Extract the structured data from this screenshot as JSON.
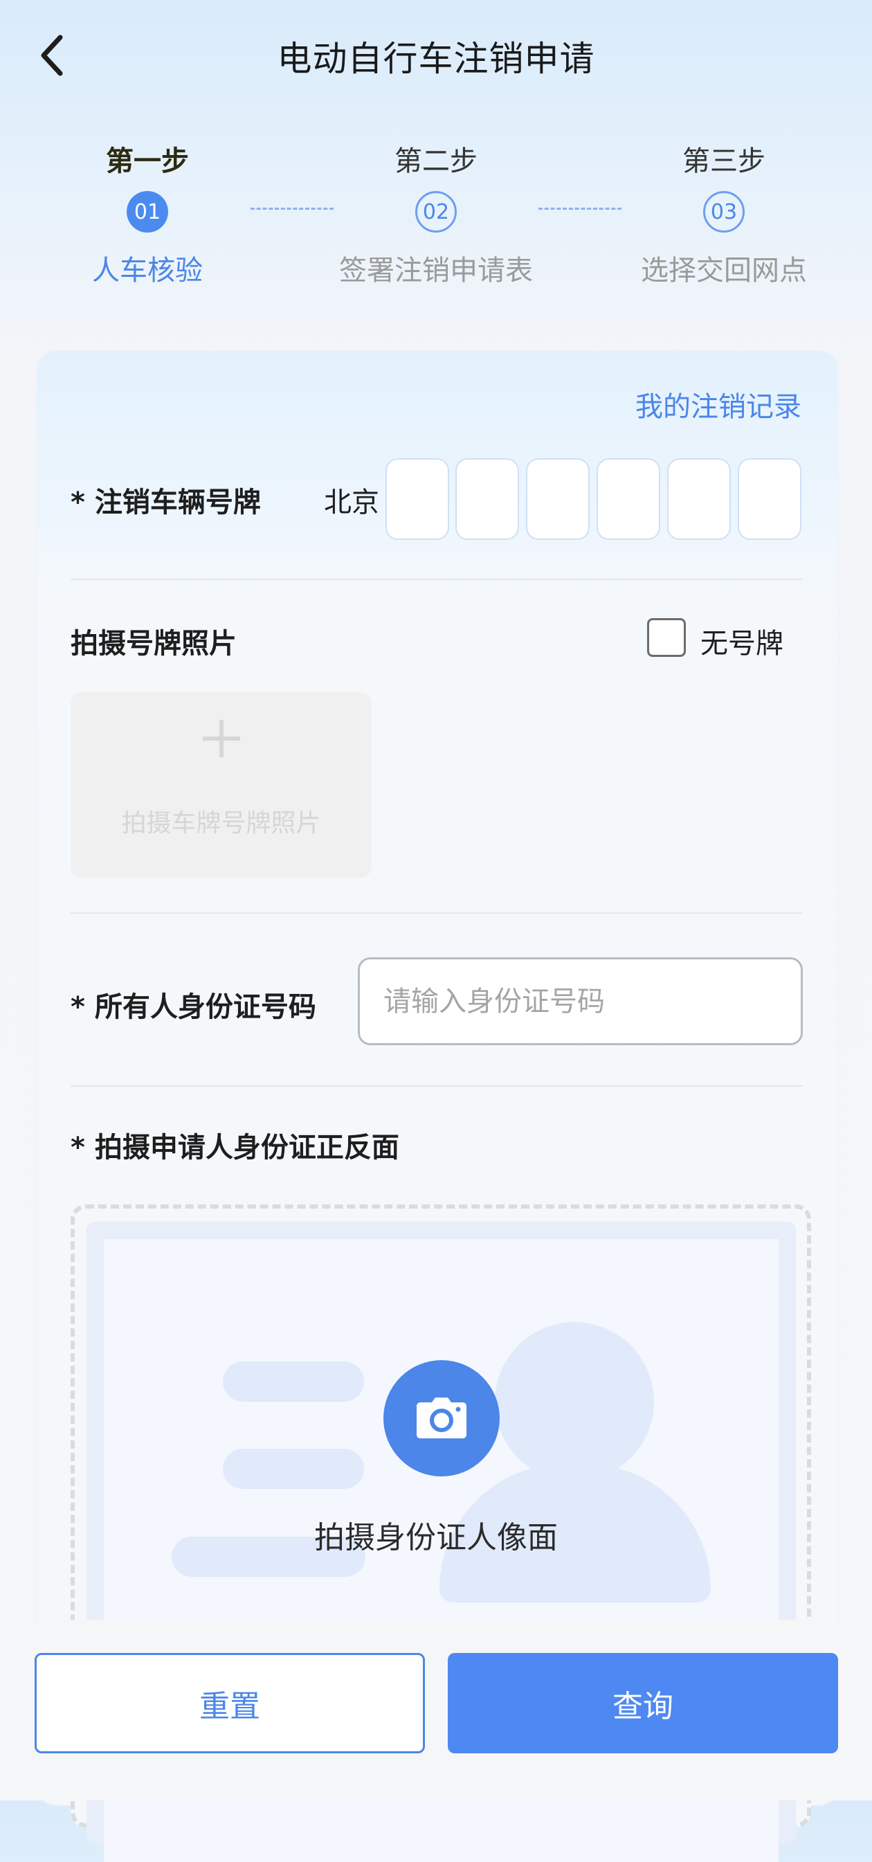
{
  "header": {
    "title": "电动自行车注销申请",
    "back_icon": "chevron-left-icon"
  },
  "steps": [
    {
      "name": "第一步",
      "number": "01",
      "desc": "人车核验",
      "active": true
    },
    {
      "name": "第二步",
      "number": "02",
      "desc": "签署注销申请表",
      "active": false
    },
    {
      "name": "第三步",
      "number": "03",
      "desc": "选择交回网点",
      "active": false
    }
  ],
  "form": {
    "record_link": "我的注销记录",
    "plate": {
      "label": "* 注销车辆号牌",
      "prefix": "北京",
      "box_count": 6
    },
    "plate_photo": {
      "label": "拍摄号牌照片",
      "no_plate_label": "无号牌",
      "no_plate_checked": false,
      "upload_text": "拍摄车牌号牌照片",
      "upload_icon": "plus-icon"
    },
    "id_number": {
      "label": "* 所有人身份证号码",
      "placeholder": "请输入身份证号码",
      "value": ""
    },
    "id_photo": {
      "label": "* 拍摄申请人身份证正反面",
      "camera_text": "拍摄身份证人像面",
      "camera_icon": "camera-icon"
    }
  },
  "actions": {
    "reset_label": "重置",
    "query_label": "查询"
  },
  "colors": {
    "accent": "#4b86e8",
    "primary_button": "#4e88f3"
  }
}
